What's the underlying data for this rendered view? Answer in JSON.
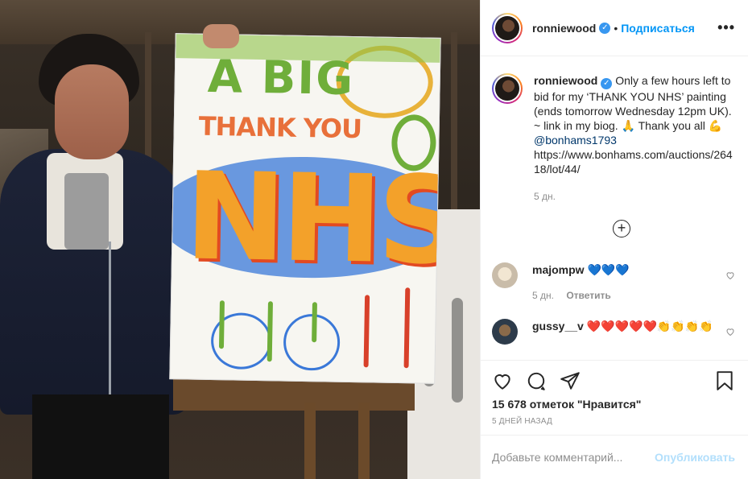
{
  "post": {
    "username": "ronniewood",
    "follow_label": "Подписаться",
    "more_label": "•••",
    "dot": "•",
    "caption_text": "Only a few hours left to bid for my ‘THANK YOU NHS’ painting (ends tomorrow Wednesday 12pm UK). ~ link in my biog. 🙏 Thank you all 💪",
    "caption_mention": "@bonhams1793",
    "caption_link": "https://www.bonhams.com/auctions/26418/lot/44/",
    "caption_age": "5 дн.",
    "load_more_symbol": "+"
  },
  "photo": {
    "painting_line1": "A BIG",
    "painting_line2": "THANK YOU",
    "painting_line3": "NHS"
  },
  "comments": [
    {
      "username": "majompw",
      "text": "💙💙💙",
      "age": "5 дн.",
      "reply_label": "Ответить",
      "avatar_color": "#d9d2c6"
    },
    {
      "username": "gussy__v",
      "text": "❤️❤️❤️❤️❤️👏👏👏👏",
      "avatar_color": "#3a4a5a"
    }
  ],
  "actions": {
    "likes": "15 678 отметок \"Нравится\"",
    "time_ago": "5 ДНЕЙ НАЗАД"
  },
  "add_comment": {
    "placeholder": "Добавьте комментарий...",
    "publish_label": "Опубликовать"
  },
  "colors": {
    "accent": "#0095f6",
    "verified": "#3897f0",
    "publish_disabled": "#b2dffc",
    "muted": "#8e8e8e"
  },
  "icons": [
    "verified-badge-icon",
    "more-options-icon",
    "load-more-icon",
    "heart-icon",
    "comment-icon",
    "share-icon",
    "bookmark-icon",
    "heart-small-icon"
  ]
}
